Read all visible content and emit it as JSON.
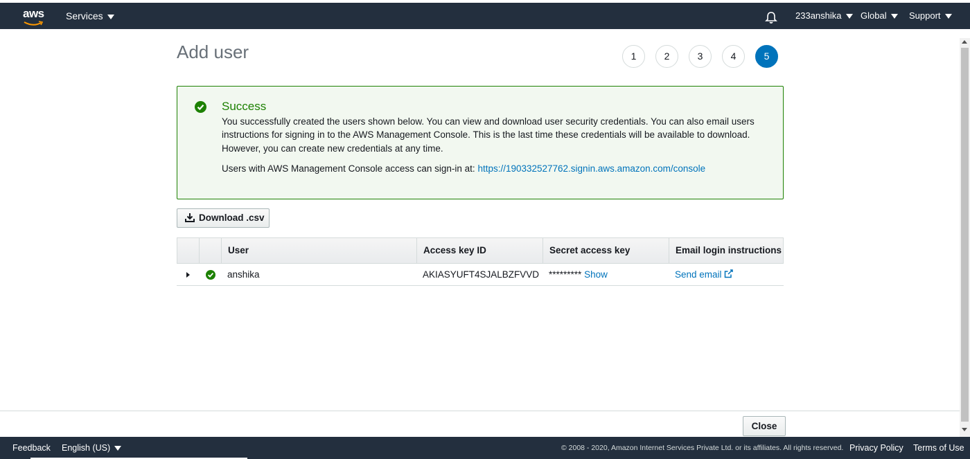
{
  "header": {
    "logo": "aws",
    "services_label": "Services",
    "account_label": "233anshika",
    "region_label": "Global",
    "support_label": "Support",
    "icons": {
      "notifications": "bell-icon",
      "caret": "caret-down-icon"
    }
  },
  "page": {
    "title": "Add user"
  },
  "steps": [
    "1",
    "2",
    "3",
    "4",
    "5"
  ],
  "active_step": "5",
  "alert": {
    "title": "Success",
    "body": "You successfully created the users shown below. You can view and download user security credentials. You can also email users instructions for signing in to the AWS Management Console. This is the last time these credentials will be available to download. However, you can create new credentials at any time.",
    "signin_prefix": "Users with AWS Management Console access can sign-in at:",
    "signin_url": "https://190332527762.signin.aws.amazon.com/console",
    "icon": "check-circle-icon"
  },
  "download_button": "Download .csv",
  "table": {
    "headers": [
      "User",
      "Access key ID",
      "Secret access key",
      "Email login instructions"
    ],
    "rows": [
      {
        "user": "anshika",
        "access_key_id": "AKIASYUFT4SJALBZFVVD",
        "secret_mask": "*********",
        "show_label": "Show",
        "email_label": "Send email"
      }
    ]
  },
  "close_button": "Close",
  "bottom_bar": {
    "feedback": "Feedback",
    "language": "English (US)",
    "copyright": "© 2008 - 2020, Amazon Internet Services Private Ltd. or its affiliates. All rights reserved.",
    "privacy": "Privacy Policy",
    "terms": "Terms of Use"
  },
  "colors": {
    "nav_bg": "#232f3e",
    "success": "#1d8102",
    "link": "#0073bb",
    "active_step": "#0073bb"
  }
}
